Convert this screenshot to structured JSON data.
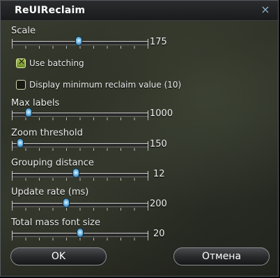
{
  "window": {
    "title": "ReUIReclaim",
    "close_glyph": "×"
  },
  "sliders": [
    {
      "label": "Scale",
      "value": "175",
      "level": 0.49
    },
    {
      "label": "Max labels",
      "value": "1000",
      "level": 0.12
    },
    {
      "label": "Zoom threshold",
      "value": "150",
      "level": 0.06
    },
    {
      "label": "Grouping distance",
      "value": "12",
      "level": 0.47
    },
    {
      "label": "Update rate (ms)",
      "value": "200",
      "level": 0.4
    },
    {
      "label": "Total mass font size",
      "value": "20",
      "level": 0.5
    }
  ],
  "checkboxes": [
    {
      "label": "Use batching",
      "checked": true,
      "mark": "✕"
    },
    {
      "label": "Display minimum reclaim value (10)",
      "checked": false,
      "mark": ""
    }
  ],
  "buttons": {
    "ok": "OK",
    "cancel": "Отмена"
  },
  "colors": {
    "thumb": "#6fb8e4",
    "checkbox_checked": "#a8bf54",
    "title_text": "#ffffff",
    "close_icon": "#8fb0c8"
  },
  "icons": {
    "close": "close-icon",
    "slider_thumb": "slider-thumb-icon",
    "checkmark": "checkmark-icon"
  }
}
